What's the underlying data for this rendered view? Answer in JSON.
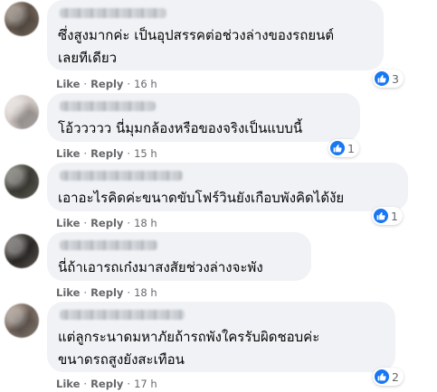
{
  "comments": [
    {
      "text": "ซึ่งสูงมากค่ะ เป็นอุปสรรคต่อช่วงล่างของรถยนต์\nเลยทีเดียว",
      "like": "Like",
      "reply": "Reply",
      "dot": "·",
      "time": "16 h",
      "reaction_count": "3"
    },
    {
      "text": "โอ้ววววว นี่มุมกล้องหรือของจริงเป็นแบบนี้",
      "like": "Like",
      "reply": "Reply",
      "dot": "·",
      "time": "15 h",
      "reaction_count": "1"
    },
    {
      "text": "เอาอะไรคิดค่ะขนาดขับโฟร์วินยังเกือบพังคิดได้งัย",
      "like": "Like",
      "reply": "Reply",
      "dot": "·",
      "time": "18 h",
      "reaction_count": "1"
    },
    {
      "text": "นี่ถ้าเอารถเก๋งมาสงสัยช่วงล่างจะพัง",
      "like": "Like",
      "reply": "Reply",
      "dot": "·",
      "time": "18 h",
      "reaction_count": ""
    },
    {
      "text": "แต่ลูกระนาดมหาภัยถ้ารถพังใครรับผิดชอบค่ะ\nขนาดรถสูงยังสะเทือน",
      "like": "Like",
      "reply": "Reply",
      "dot": "·",
      "time": "17 h",
      "reaction_count": "2"
    }
  ],
  "icons": {
    "reaction": "thumbs-up-icon"
  },
  "colors": {
    "bubble": "#f0f2f5",
    "meta_text": "#65676b",
    "like_blue": "#1877f2"
  }
}
